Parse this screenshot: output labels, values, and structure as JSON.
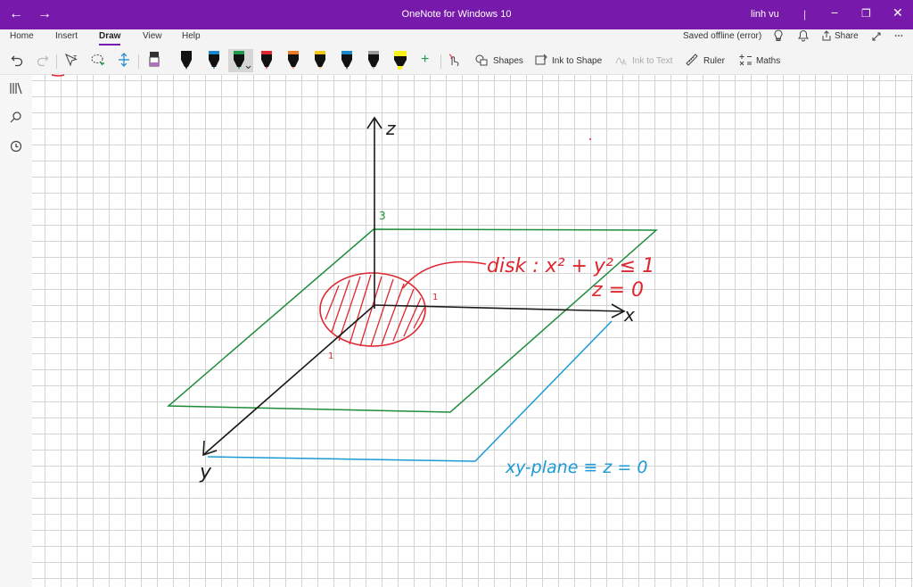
{
  "titlebar": {
    "title": "OneNote for Windows 10",
    "user": "linh vu",
    "back_icon": "←",
    "forward_icon": "→",
    "separator": "|"
  },
  "window_controls": {
    "minimize": "−",
    "maximize": "❐",
    "close": "✕"
  },
  "ribbon": {
    "tabs": [
      "Home",
      "Insert",
      "Draw",
      "View",
      "Help"
    ],
    "active_tab": "Draw",
    "status": "Saved offline (error)",
    "share_label": "Share"
  },
  "toolbar": {
    "shapes": "Shapes",
    "ink_to_shape": "Ink to Shape",
    "ink_to_text": "Ink to Text",
    "ruler": "Ruler",
    "maths": "Maths",
    "pens": [
      {
        "color": "#b36fbf",
        "type": "eraser"
      },
      {
        "color": "#000000",
        "type": "pen"
      },
      {
        "color": "#1a88c9",
        "type": "pen"
      },
      {
        "color": "#1a9a4a",
        "type": "pen"
      },
      {
        "color": "#e0262f",
        "type": "pen"
      },
      {
        "color": "#f07a20",
        "type": "pen"
      },
      {
        "color": "#f5c518",
        "type": "pen"
      },
      {
        "color": "#1b1b1b",
        "type": "pen"
      },
      {
        "color": "#9a9a9a",
        "type": "pen"
      },
      {
        "color": "#f7f31a",
        "type": "highlighter"
      }
    ],
    "selected_pen_color": "#1a9a4a"
  },
  "colors": {
    "titlebar": "#7719aa",
    "ink_black": "#1a1a1a",
    "ink_red": "#e0262f",
    "ink_green": "#1f8c3a",
    "ink_blue": "#1b9ad6"
  },
  "sidebar_icons": [
    "notebooks-icon",
    "search-icon",
    "recent-icon"
  ],
  "ink": {
    "z_label": "z",
    "x_label": "x",
    "y_label": "y",
    "z_tick": "3",
    "x_tick": "1",
    "y_tick": "1",
    "disk_line1": "disk : x² + y² ≤ 1",
    "disk_line2": "z = 0",
    "plane_label": "xy-plane ≡ z = 0"
  }
}
